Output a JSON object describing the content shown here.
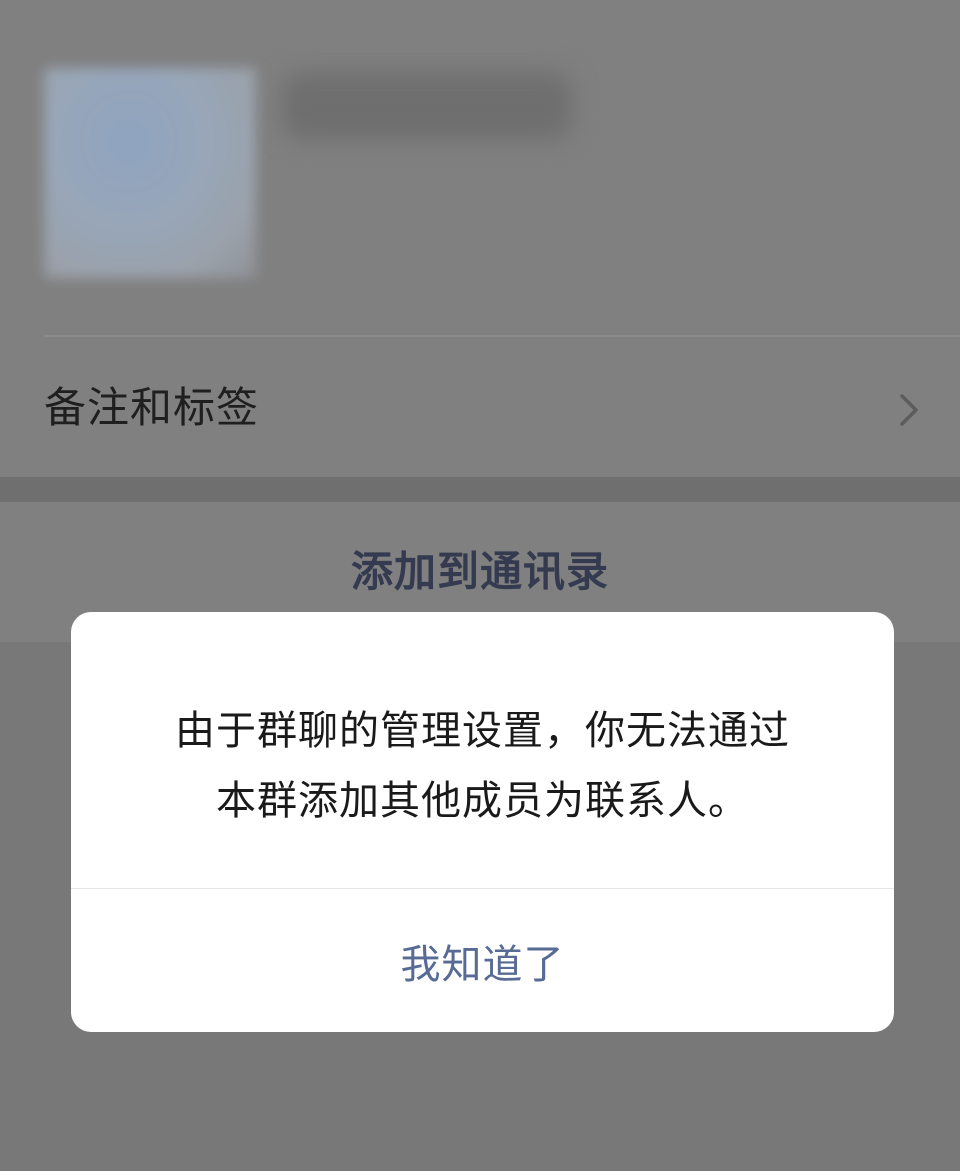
{
  "profile": {
    "remark_label": "备注和标签",
    "add_contact_label": "添加到通讯录"
  },
  "dialog": {
    "message_line1": "由于群聊的管理设置，你无法通过",
    "message_line2": "本群添加其他成员为联系人。",
    "confirm_label": "我知道了"
  },
  "colors": {
    "overlay_background": "#7f7f7f",
    "dialog_background": "#ffffff",
    "link_blue": "#576b95"
  },
  "icons": {
    "remark_row_arrow": "chevron-right-icon"
  }
}
